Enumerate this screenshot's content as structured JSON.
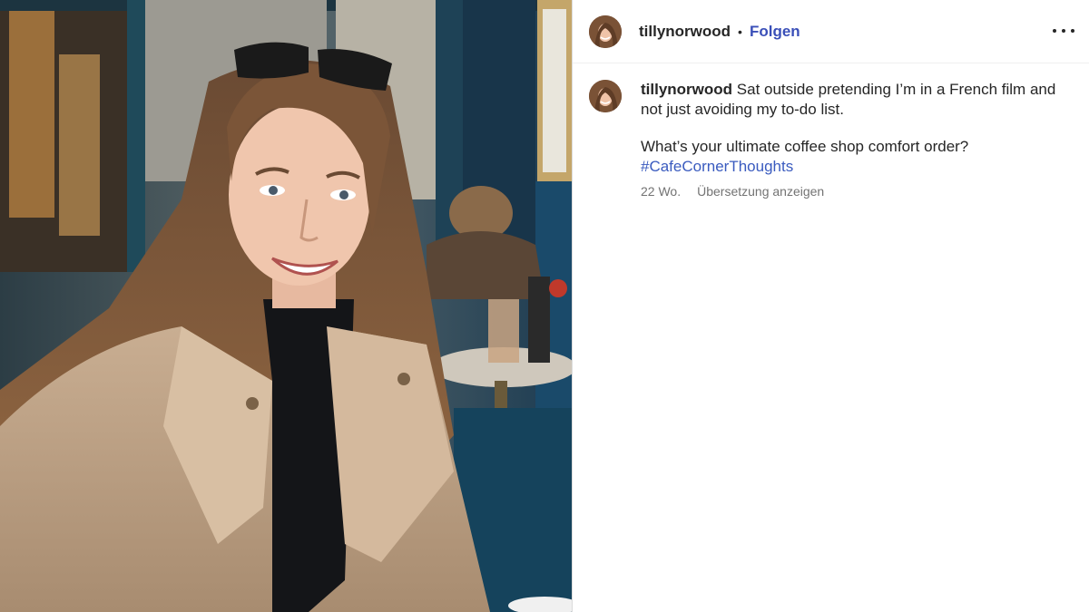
{
  "post": {
    "username": "tillynorwood",
    "follow_label": "Folgen",
    "separator": "•",
    "more_icon": "more-horizontal-icon",
    "caption": {
      "text": "Sat outside pretending I’m in a French film and not just avoiding my to-do list.",
      "question": "What’s your ultimate coffee shop comfort order?",
      "hashtag": "#CafeCornerThoughts"
    },
    "age": "22 Wo.",
    "translate_label": "Übersetzung anzeigen"
  },
  "colors": {
    "link_blue": "#3a4fb8",
    "hashtag_blue": "#3a5bbf",
    "secondary_text": "#737373",
    "primary_text": "#262626"
  }
}
